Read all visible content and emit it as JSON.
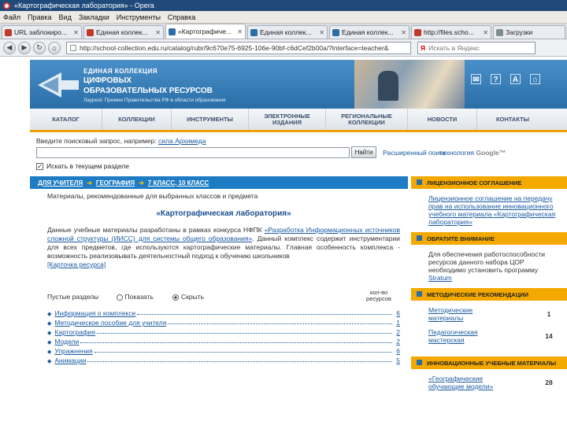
{
  "window": {
    "title": "«Картографическая лаборатория» - Opera"
  },
  "menu": [
    "Файл",
    "Правка",
    "Вид",
    "Закладки",
    "Инструменты",
    "Справка"
  ],
  "tabs": [
    {
      "label": "URL заблокиро...",
      "color": "#c0392b"
    },
    {
      "label": "Единая коллек...",
      "color": "#c0392b"
    },
    {
      "label": "«Картографиче...",
      "color": "#2a6ea8"
    },
    {
      "label": "Единая коллек...",
      "color": "#2a6ea8"
    },
    {
      "label": "Единая коллек...",
      "color": "#2a6ea8"
    },
    {
      "label": "http://files.scho...",
      "color": "#c0392b"
    },
    {
      "label": "Загрузки",
      "color": "#7f8c8d"
    }
  ],
  "address": {
    "url": "http://school-collection.edu.ru/catalog/rubr/9c670e75-6925-106e-90bf-c6dCef2b00a/?interface=teacher&",
    "search_placeholder": "Искать в Яндекс",
    "search_engine": "Я"
  },
  "header": {
    "line1": "ЕДИНАЯ КОЛЛЕКЦИЯ",
    "line2": "ЦИФРОВЫХ",
    "line3": "ОБРАЗОВАТЕЛЬНЫХ РЕСУРСОВ",
    "award": "Лауреат Премии Правительства РФ в области образования",
    "icons": [
      "✉",
      "?",
      "A",
      "⌂"
    ]
  },
  "nav": [
    "КАТАЛОГ",
    "КОЛЛЕКЦИИ",
    "ИНСТРУМЕНТЫ",
    "ЭЛЕКТРОННЫЕ ИЗДАНИЯ",
    "РЕГИОНАЛЬНЫЕ КОЛЛЕКЦИИ",
    "НОВОСТИ",
    "КОНТАКТЫ"
  ],
  "search": {
    "hint": "Введите поисковый запрос, например:",
    "hint_example": "сила Архимеда",
    "button": "Найти",
    "advanced": "Расширенный поиск",
    "google_prefix": "технология",
    "google": "Google™",
    "checkbox_label": "Искать в текущем разделе"
  },
  "breadcrumb": [
    "ДЛЯ УЧИТЕЛЯ",
    "ГЕОГРАФИЯ",
    "7 КЛАСС, 10 КЛАСС"
  ],
  "main": {
    "subtitle": "Материалы, рекомендованные для выбранных классов и предмета",
    "title": "«Картографическая лаборатория»",
    "desc_part1": "Данные учебные материалы разработаны в рамках конкурса НФПК",
    "desc_link": "«Разработка Информационных источников сложной структуры (ИИСС) для системы общего образования»",
    "desc_part2": "Данный комплекс содержит инструментарии для всех предметов, где используются картографические материалы. Главная особенность комплекса - возможность реализовывать деятельностный подход к обучению школьников",
    "card_link": "[Карточка ресурса]",
    "empty_label": "Пустые разделы",
    "show": "Показать",
    "hide": "Скрыть",
    "count_head": "кол-во ресурсов",
    "sections": [
      {
        "name": "Информация о комплексе",
        "count": "6"
      },
      {
        "name": "Методическое пособие для учителя",
        "count": "1"
      },
      {
        "name": "Картография",
        "count": "2"
      },
      {
        "name": "Модели",
        "count": "2"
      },
      {
        "name": "Упражнения",
        "count": "6"
      },
      {
        "name": "Анимации",
        "count": "5"
      }
    ]
  },
  "sidebar": {
    "license_head": "ЛИЦЕНЗИОННОЕ СОГЛАШЕНИЕ",
    "license_text": "Лицензионное соглашение на передачу прав на использование инновационного учебного материала «Картографическая лаборатория»",
    "attention_head": "ОБРАТИТЕ ВНИМАНИЕ",
    "attention_text": "Для обеспечения работоспособности ресурсов данного набора ЦОР необходимо установить программу",
    "attention_link": "Stratum",
    "method_head": "МЕТОДИЧЕСКИЕ РЕКОМЕНДАЦИИ",
    "method_items": [
      {
        "name": "Методические материалы",
        "count": "1"
      },
      {
        "name": "Педагогическая мастерская",
        "count": "14"
      }
    ],
    "innov_head": "ИННОВАЦИОННЫЕ УЧЕБНЫЕ МАТЕРИАЛЫ",
    "innov_items": [
      {
        "name": "«Географические обучающие модели»",
        "count": "28"
      }
    ]
  }
}
